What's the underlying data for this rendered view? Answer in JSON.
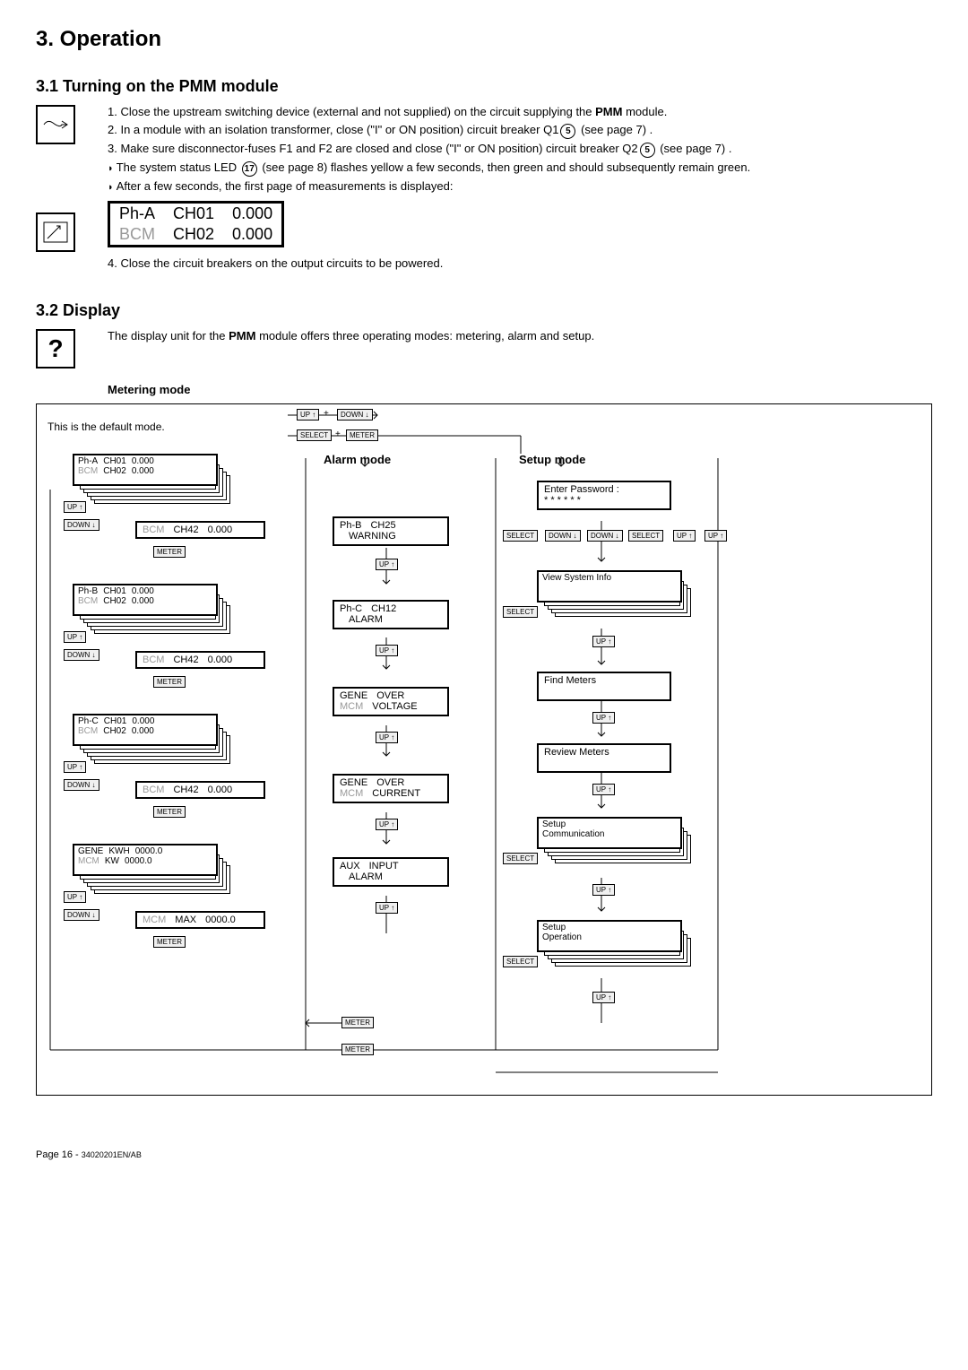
{
  "title": "3. Operation",
  "section31": {
    "heading": "3.1 Turning on the PMM module",
    "step1_pre": "1. Close the upstream switching device (external and not supplied) on the circuit supplying the ",
    "step1_bold": "PMM",
    "step1_post": " module.",
    "step2_pre": "2. In a module with an isolation transformer, close (\"I\" or ON position) circuit breaker Q1",
    "step2_circ": "5",
    "step2_post": " (see page 7) .",
    "step3_pre": "3. Make sure disconnector-fuses F1 and F2 are closed and close (\"I\" or ON position) circuit breaker Q2",
    "step3_circ": "5",
    "step3_post": " (see page 7) .",
    "bullet1_pre": "The system status LED ",
    "bullet1_circ": "17",
    "bullet1_post": " (see page 8) flashes yellow a few seconds, then green and should subsequently remain green.",
    "bullet2": "After a few seconds, the first page of measurements is displayed:",
    "lcd": {
      "r1c1": "Ph-A",
      "r1c2": "CH01",
      "r1c3": "0.000",
      "r2c1": "BCM",
      "r2c2": "CH02",
      "r2c3": "0.000"
    },
    "step4": "4. Close the circuit breakers on the output circuits to be powered."
  },
  "section32": {
    "heading": "3.2 Display",
    "intro_pre": "The display unit for the ",
    "intro_bold": "PMM",
    "intro_post": " module offers three operating modes:  metering, alarm and setup.",
    "metering_heading": "Metering mode",
    "metering_note": "This is the default mode.",
    "alarm_heading": "Alarm      mode",
    "setup_heading": "Setup      mode"
  },
  "buttons": {
    "up": "UP",
    "down": "DOWN",
    "meter": "METER",
    "select": "SELECT",
    "plus": "+"
  },
  "screens": {
    "phA_1": {
      "a": "Ph-A",
      "b": "CH01",
      "c": "0.000",
      "d": "BCM",
      "e": "CH02",
      "f": "0.000"
    },
    "phA_2": {
      "a": "BCM",
      "b": "CH42",
      "c": "0.000"
    },
    "phB_1": {
      "a": "Ph-B",
      "b": "CH01",
      "c": "0.000",
      "d": "BCM",
      "e": "CH02",
      "f": "0.000"
    },
    "phB_2": {
      "a": "BCM",
      "b": "CH42",
      "c": "0.000"
    },
    "phC_1": {
      "a": "Ph-C",
      "b": "CH01",
      "c": "0.000",
      "d": "BCM",
      "e": "CH02",
      "f": "0.000"
    },
    "phC_2": {
      "a": "BCM",
      "b": "CH42",
      "c": "0.000"
    },
    "gene_1": {
      "a": "GENE",
      "b": "KWH",
      "c": "0000.0",
      "d": "MCM",
      "e": "KW",
      "f": "0000.0"
    },
    "gene_2": {
      "a": "MCM",
      "b": "MAX",
      "c": "0000.0"
    },
    "alarm1": {
      "a": "Ph-B",
      "b": "CH25",
      "c": "WARNING"
    },
    "alarm2": {
      "a": "Ph-C",
      "b": "CH12",
      "c": "ALARM"
    },
    "alarm3": {
      "a": "GENE",
      "b": "OVER",
      "c": "MCM",
      "d": "VOLTAGE"
    },
    "alarm4": {
      "a": "GENE",
      "b": "OVER",
      "c": "MCM",
      "d": "CURRENT"
    },
    "alarm5": {
      "a": "AUX",
      "b": "INPUT",
      "c": "ALARM"
    },
    "setup1": {
      "a": "Enter Password :",
      "b": "* * * * * *"
    },
    "setup2": {
      "a": "View System Info"
    },
    "setup3": {
      "a": "Find Meters"
    },
    "setup4": {
      "a": "Review Meters"
    },
    "setup5": {
      "a": "Setup",
      "b": "Communication"
    },
    "setup6": {
      "a": "Setup",
      "b": "Operation"
    }
  },
  "footer": {
    "page": "Page 16 - ",
    "doc": "34020201EN/AB"
  }
}
